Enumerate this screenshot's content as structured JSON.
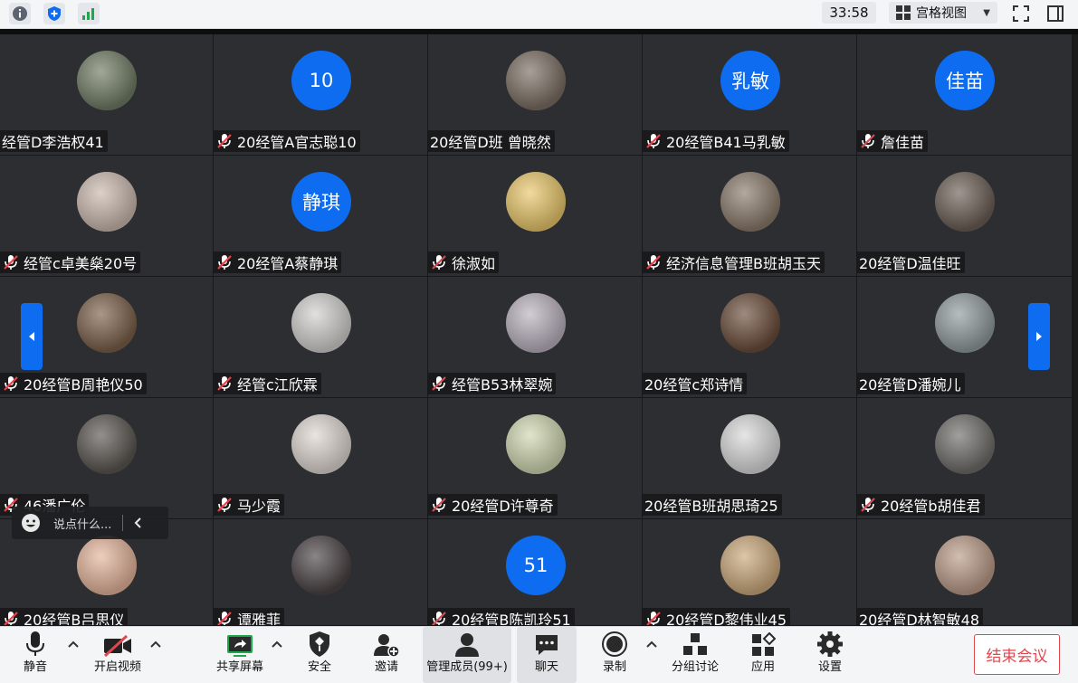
{
  "topbar": {
    "timer": "33:58",
    "view_label": "宫格视图",
    "view_caret": "▼"
  },
  "participants": [
    {
      "name": "经管D李浩权41",
      "muted": false,
      "avatar": {
        "type": "photo",
        "color": "#6f7a63"
      }
    },
    {
      "name": "20经管A官志聪10",
      "muted": true,
      "avatar": {
        "type": "initials",
        "text": "10"
      }
    },
    {
      "name": "20经管D班 曾晓然",
      "muted": false,
      "avatar": {
        "type": "photo",
        "color": "#7a6d62"
      }
    },
    {
      "name": "20经管B41马乳敏",
      "muted": true,
      "avatar": {
        "type": "initials",
        "text": "乳敏"
      }
    },
    {
      "name": "詹佳苗",
      "muted": true,
      "avatar": {
        "type": "initials",
        "text": "佳苗"
      }
    },
    {
      "name": "经管c卓美燊20号",
      "muted": true,
      "avatar": {
        "type": "photo",
        "color": "#c9b8ad"
      }
    },
    {
      "name": "20经管A蔡静琪",
      "muted": true,
      "avatar": {
        "type": "initials",
        "text": "静琪"
      }
    },
    {
      "name": "徐淑如",
      "muted": true,
      "avatar": {
        "type": "photo",
        "color": "#e8c66a"
      }
    },
    {
      "name": "经济信息管理B班胡玉天",
      "muted": true,
      "avatar": {
        "type": "photo",
        "color": "#8a7a6a"
      }
    },
    {
      "name": "20经管D温佳旺",
      "muted": false,
      "avatar": {
        "type": "photo",
        "color": "#6b5e55"
      }
    },
    {
      "name": "20经管B周艳仪50",
      "muted": true,
      "avatar": {
        "type": "photo",
        "color": "#7a5f48"
      }
    },
    {
      "name": "经管c江欣霖",
      "muted": true,
      "avatar": {
        "type": "photo",
        "color": "#d0cfcc"
      }
    },
    {
      "name": "经管B53林翠婉",
      "muted": true,
      "avatar": {
        "type": "photo",
        "color": "#b9b0bd"
      }
    },
    {
      "name": "20经管c郑诗情",
      "muted": false,
      "avatar": {
        "type": "photo",
        "color": "#6a4c3a"
      }
    },
    {
      "name": "20经管D潘婉儿",
      "muted": false,
      "avatar": {
        "type": "photo",
        "color": "#8f9a9c"
      }
    },
    {
      "name": "46潘广伦",
      "muted": true,
      "avatar": {
        "type": "photo",
        "color": "#5a5550"
      }
    },
    {
      "name": "马少霞",
      "muted": true,
      "avatar": {
        "type": "photo",
        "color": "#ddd6d0"
      }
    },
    {
      "name": "20经管D许尊奇",
      "muted": true,
      "avatar": {
        "type": "photo",
        "color": "#cfd6b0"
      }
    },
    {
      "name": "20经管B班胡思琦25",
      "muted": false,
      "avatar": {
        "type": "photo",
        "color": "#d8d8d8"
      }
    },
    {
      "name": "20经管b胡佳君",
      "muted": true,
      "avatar": {
        "type": "photo",
        "color": "#6e6c68"
      }
    },
    {
      "name": "20经管B吕思仪",
      "muted": true,
      "avatar": {
        "type": "photo",
        "color": "#e3b39a"
      }
    },
    {
      "name": "谭雅菲",
      "muted": true,
      "avatar": {
        "type": "photo",
        "color": "#4a4244"
      }
    },
    {
      "name": "20经管B陈凯玲51",
      "muted": true,
      "avatar": {
        "type": "initials",
        "text": "51"
      }
    },
    {
      "name": "20经管D黎伟业45",
      "muted": true,
      "avatar": {
        "type": "photo",
        "color": "#c9a77a"
      }
    },
    {
      "name": "20经管D林智敏48",
      "muted": false,
      "avatar": {
        "type": "photo",
        "color": "#b99a87"
      }
    }
  ],
  "chat": {
    "placeholder": "说点什么..."
  },
  "toolbar": {
    "mute_label": "静音",
    "video_label": "开启视频",
    "share_label": "共享屏幕",
    "security_label": "安全",
    "invite_label": "邀请",
    "members_label": "管理成员(99+)",
    "chat_label": "聊天",
    "record_label": "录制",
    "breakout_label": "分组讨论",
    "apps_label": "应用",
    "settings_label": "设置",
    "end_label": "结束会议"
  },
  "colors": {
    "accent": "#0e6cf0",
    "end_red": "#e0474f",
    "tile_bg": "#2c2e32",
    "share_green": "#1fa84b"
  }
}
